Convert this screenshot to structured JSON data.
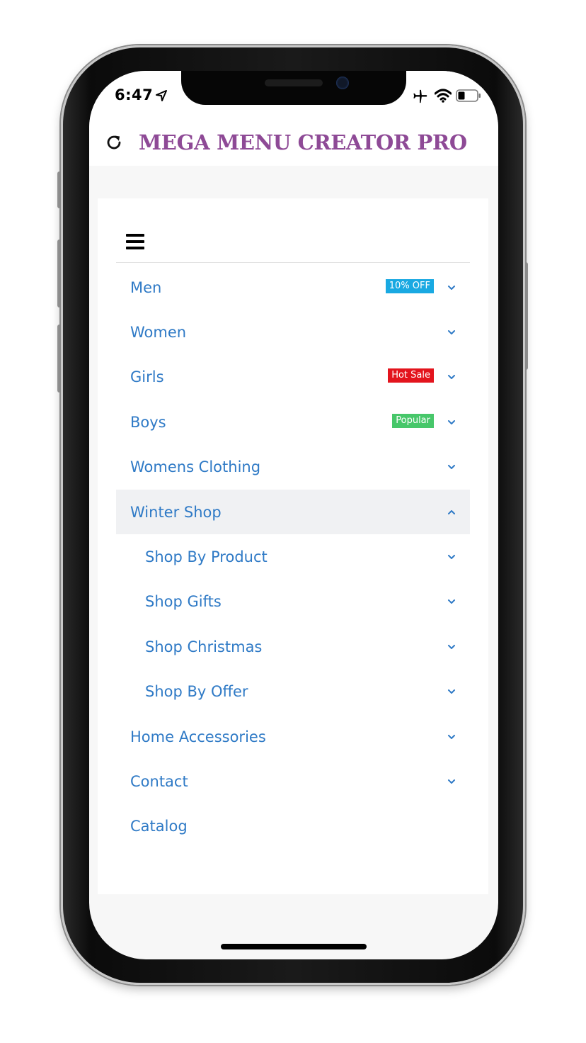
{
  "status_bar": {
    "time": "6:47",
    "icons": [
      "location-arrow-icon",
      "airplane-icon",
      "wifi-icon",
      "battery-icon"
    ]
  },
  "header": {
    "title": "MEGA MENU CREATOR PRO",
    "title_color": "#8e4a96",
    "icon": "reload-icon"
  },
  "menu": {
    "toggle_icon": "hamburger-icon",
    "link_color": "#2f7ac6",
    "items": [
      {
        "label": "Men",
        "badge": "10% OFF",
        "badge_color": "#19a9e2",
        "chevron": "down"
      },
      {
        "label": "Women",
        "badge": "",
        "chevron": "down"
      },
      {
        "label": "Girls",
        "badge": "Hot Sale",
        "badge_color": "#e3141d",
        "chevron": "down"
      },
      {
        "label": "Boys",
        "badge": "Popular",
        "badge_color": "#47c76a",
        "chevron": "down"
      },
      {
        "label": "Womens Clothing",
        "badge": "",
        "chevron": "down"
      },
      {
        "label": "Winter Shop",
        "badge": "",
        "chevron": "up",
        "expanded": true
      },
      {
        "label": "Shop By Product",
        "badge": "",
        "chevron": "down",
        "sub": true
      },
      {
        "label": "Shop Gifts",
        "badge": "",
        "chevron": "down",
        "sub": true
      },
      {
        "label": "Shop Christmas",
        "badge": "",
        "chevron": "down",
        "sub": true
      },
      {
        "label": "Shop By Offer",
        "badge": "",
        "chevron": "down",
        "sub": true
      },
      {
        "label": "Home Accessories",
        "badge": "",
        "chevron": "down"
      },
      {
        "label": "Contact",
        "badge": "",
        "chevron": "down"
      },
      {
        "label": "Catalog",
        "badge": "",
        "chevron": "none"
      }
    ]
  }
}
